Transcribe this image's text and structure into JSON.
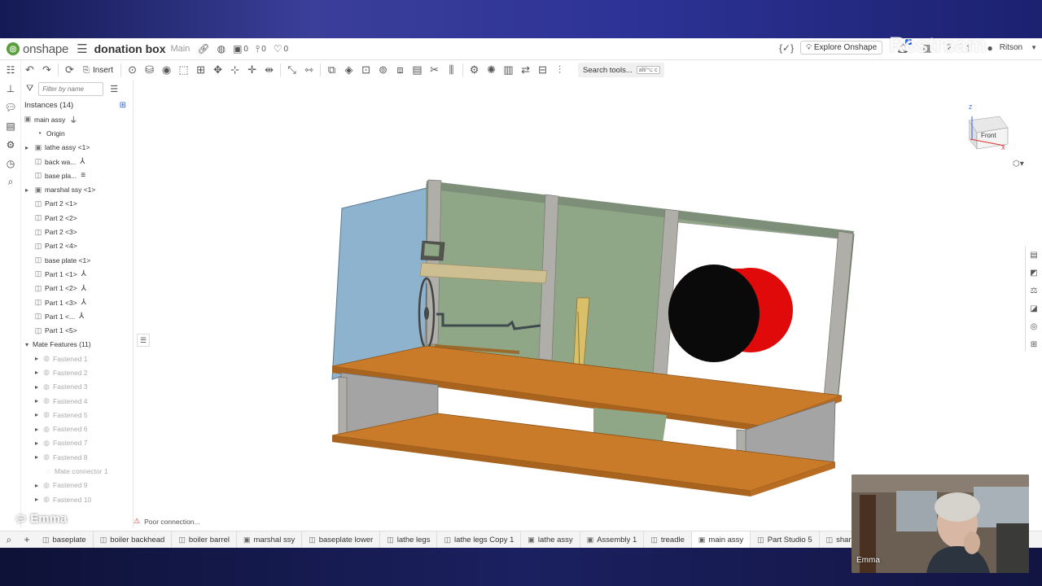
{
  "app": {
    "logo_text": "onshape",
    "doc_title": "donation box",
    "branch": "Main",
    "versions_count": "0",
    "branches_count": "0",
    "likes_count": "0",
    "explore_label": "Explore Onshape",
    "user_name": "Ritson",
    "notification_count": "1"
  },
  "toolbar": {
    "insert_label": "Insert",
    "search_label": "Search tools...",
    "search_shortcut": "alt/⌥ c"
  },
  "panel": {
    "filter_placeholder": "Filter by name",
    "instances_title": "Instances (14)",
    "items": [
      {
        "label": "main assy"
      },
      {
        "label": "Origin"
      },
      {
        "label": "lathe assy <1>"
      },
      {
        "label": "back wa..."
      },
      {
        "label": "base pla..."
      },
      {
        "label": "marshal ssy <1>"
      },
      {
        "label": "Part 2 <1>"
      },
      {
        "label": "Part 2 <2>"
      },
      {
        "label": "Part 2 <3>"
      },
      {
        "label": "Part 2 <4>"
      },
      {
        "label": "base plate <1>"
      },
      {
        "label": "Part 1 <1>"
      },
      {
        "label": "Part 1 <2>"
      },
      {
        "label": "Part 1 <3>"
      },
      {
        "label": "Part 1 <..."
      },
      {
        "label": "Part 1 <5>"
      },
      {
        "label": "Mate Features (11)"
      },
      {
        "label": "Fastened 1"
      },
      {
        "label": "Fastened 2"
      },
      {
        "label": "Fastened 3"
      },
      {
        "label": "Fastened 4"
      },
      {
        "label": "Fastened 5"
      },
      {
        "label": "Fastened 6"
      },
      {
        "label": "Fastened 7"
      },
      {
        "label": "Fastened 8"
      },
      {
        "label": "Mate connector 1"
      },
      {
        "label": "Fastened 9"
      },
      {
        "label": "Fastened 10"
      }
    ]
  },
  "viewcube": {
    "face": "Front",
    "axis_z": "Z",
    "axis_x": "X"
  },
  "status": {
    "text": "Poor connection..."
  },
  "tabs": [
    {
      "label": "baseplate"
    },
    {
      "label": "boiler backhead"
    },
    {
      "label": "boiler barrel"
    },
    {
      "label": "marshal ssy"
    },
    {
      "label": "baseplate lower"
    },
    {
      "label": "lathe legs"
    },
    {
      "label": "lathe legs Copy 1"
    },
    {
      "label": "lathe assy"
    },
    {
      "label": "Assembly 1"
    },
    {
      "label": "treadle"
    },
    {
      "label": "main assy"
    },
    {
      "label": "Part Studio 5"
    },
    {
      "label": "shar"
    }
  ],
  "overlay": {
    "restream_label": "Restream",
    "presenter_label": "Emma",
    "webcam_name": "Emma"
  },
  "colors": {
    "wood": "#c97b2a",
    "back_panel": "#8fa786",
    "side_panel": "#8eb3cf",
    "drum_red": "#e00a0a",
    "drum_black": "#0a0a0a"
  }
}
